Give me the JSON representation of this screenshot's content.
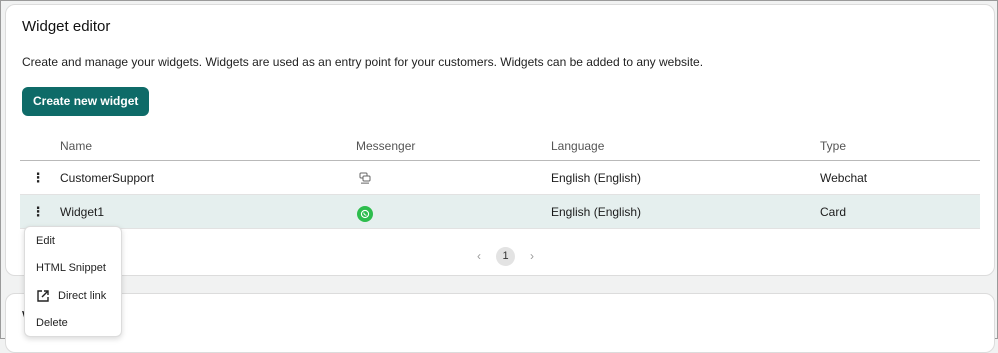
{
  "widget_editor": {
    "title": "Widget editor",
    "description": "Create and manage your widgets. Widgets are used as an entry point for your customers. Widgets can be added to any website.",
    "create_button": "Create new widget"
  },
  "table": {
    "headers": {
      "name": "Name",
      "messenger": "Messenger",
      "language": "Language",
      "type": "Type"
    },
    "rows": [
      {
        "name": "CustomerSupport",
        "messenger_icon": "webchat-icon",
        "language": "English (English)",
        "type": "Webchat"
      },
      {
        "name": "Widget1",
        "messenger_icon": "whatsapp-icon",
        "language": "English (English)",
        "type": "Card"
      }
    ]
  },
  "pagination": {
    "current_page": "1"
  },
  "context_menu": {
    "items": [
      "Edit",
      "HTML Snippet",
      "Direct link",
      "Delete"
    ]
  },
  "second_card": {
    "title_partial": "W"
  },
  "colors": {
    "accent": "#0e6b68",
    "selected_row": "#e5efee",
    "whatsapp": "#2dbd4d"
  }
}
